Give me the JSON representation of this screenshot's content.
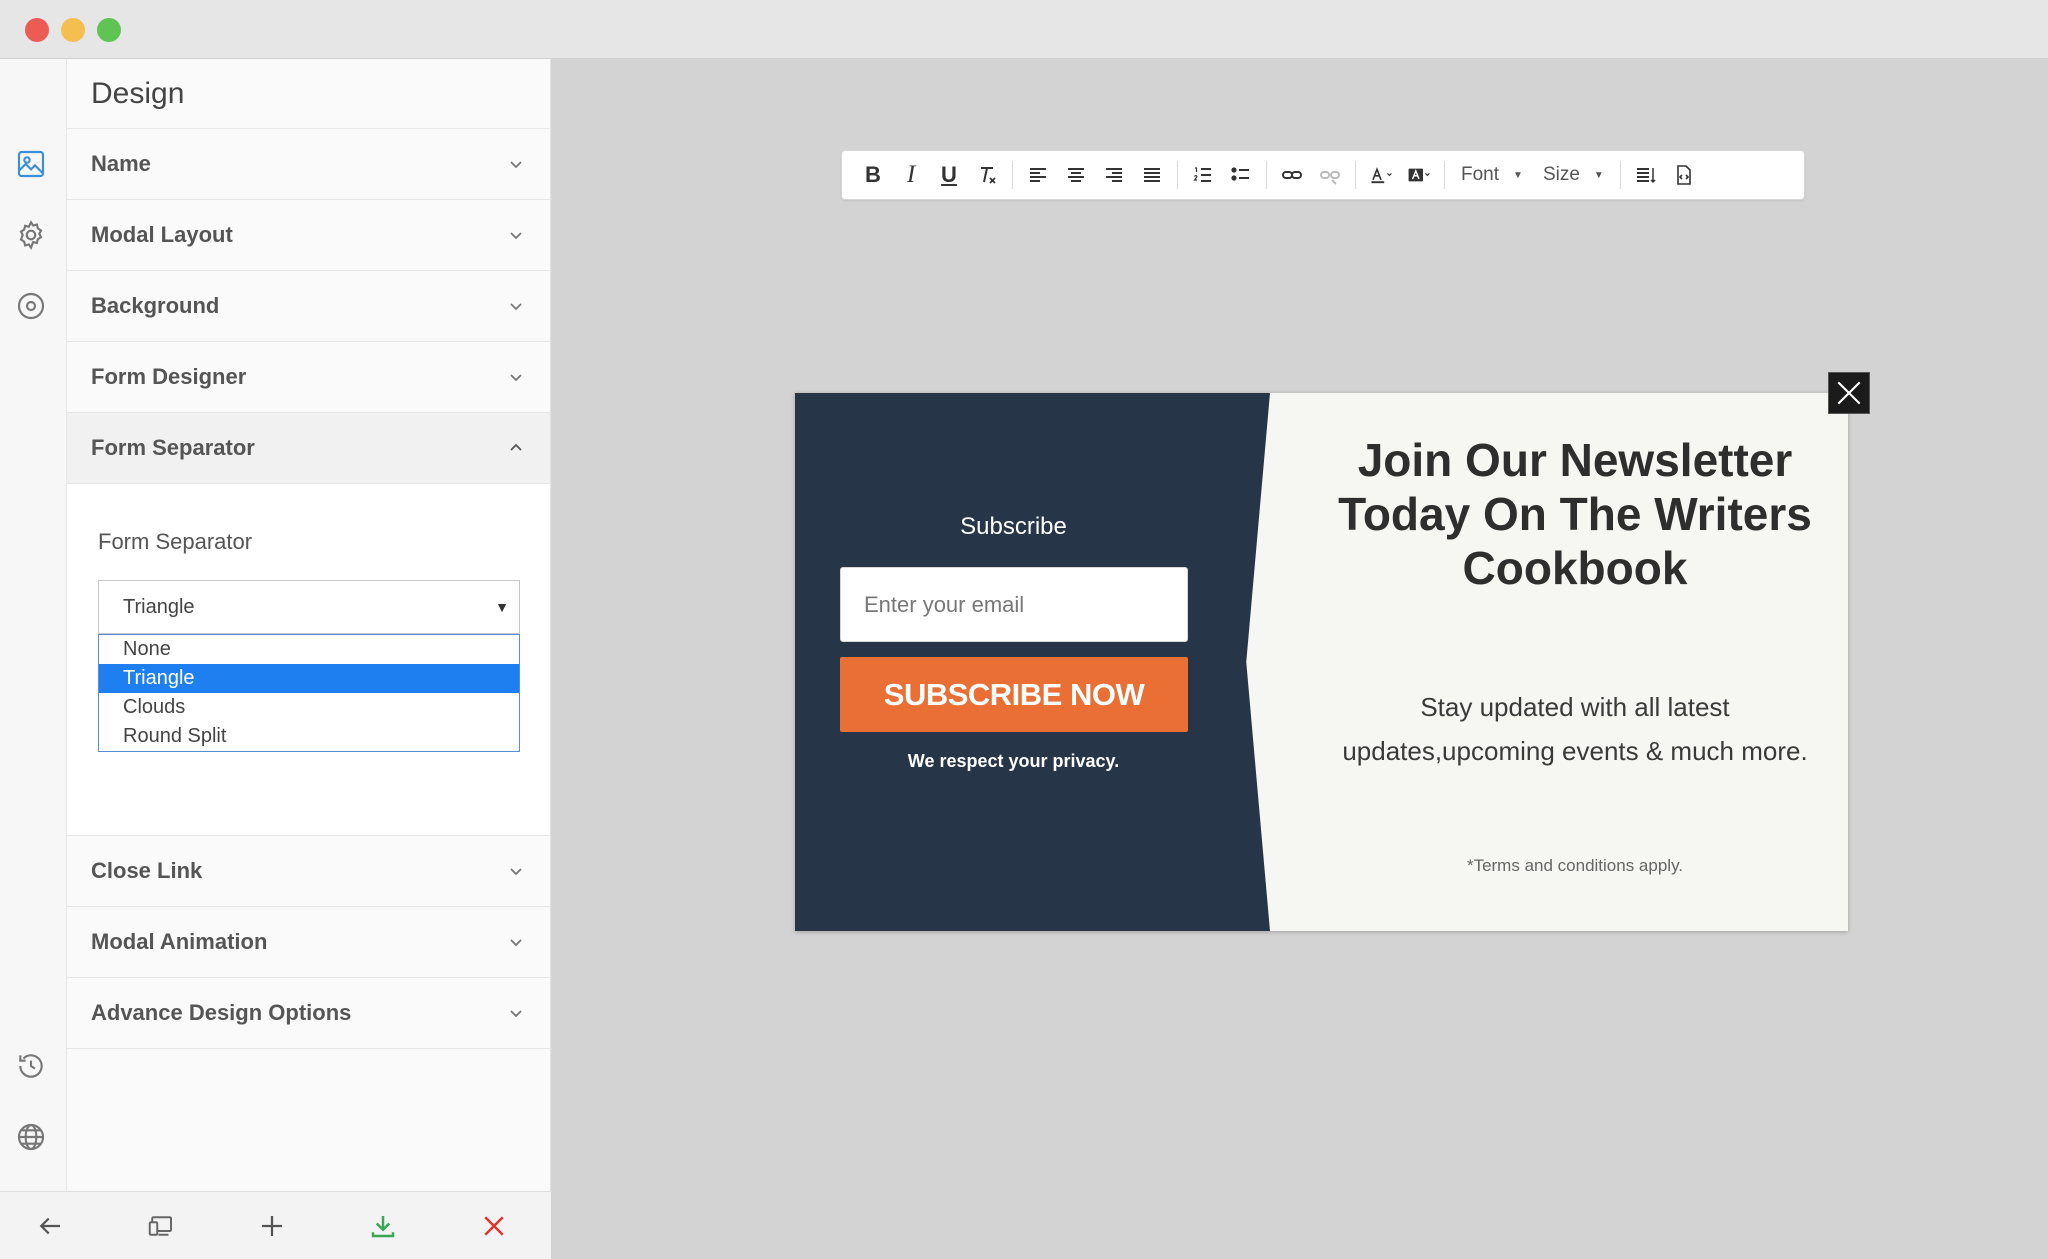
{
  "panel": {
    "title": "Design",
    "sections": {
      "name": "Name",
      "modal_layout": "Modal Layout",
      "background": "Background",
      "form_designer": "Form Designer",
      "form_separator": "Form Separator",
      "close_link": "Close Link",
      "modal_animation": "Modal Animation",
      "advance_design_options": "Advance Design Options"
    },
    "form_separator": {
      "label": "Form Separator",
      "selected": "Triangle",
      "options": [
        "None",
        "Triangle",
        "Clouds",
        "Round Split"
      ]
    }
  },
  "rail_icons": [
    "image-icon",
    "gear-icon",
    "target-icon",
    "history-icon",
    "globe-icon"
  ],
  "bottombar_icons": [
    "back-arrow-icon",
    "device-preview-icon",
    "plus-icon",
    "download-icon",
    "close-icon"
  ],
  "toolbar": {
    "bold": "B",
    "italic": "I",
    "underline": "U",
    "font_label": "Font",
    "size_label": "Size"
  },
  "modal": {
    "subscribe_title": "Subscribe",
    "email_placeholder": "Enter your email",
    "button_label": "SUBSCRIBE NOW",
    "privacy_text": "We respect your privacy.",
    "headline": "Join Our Newsletter Today On The Writers Cookbook",
    "subtext": "Stay updated with all latest updates,upcoming events & much more.",
    "terms": "*Terms and conditions apply."
  },
  "colors": {
    "modal_left_bg": "#263648",
    "modal_right_bg": "#f6f6f2",
    "button_orange": "#ea6f35",
    "dropdown_highlight": "#1e80f0",
    "download_green": "#3aa655",
    "close_red": "#e0362c"
  }
}
